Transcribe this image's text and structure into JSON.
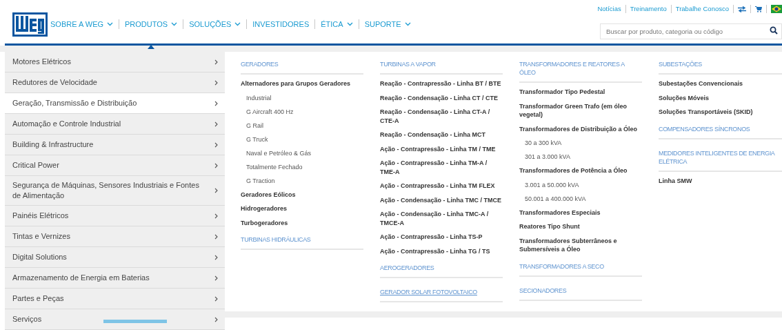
{
  "top_links": [
    "Notícias",
    "Treinamento",
    "Trabalhe Conosco"
  ],
  "search": {
    "placeholder": "Buscar por produto, categoria ou código"
  },
  "nav": [
    {
      "label": "SOBRE A WEG",
      "dropdown": true,
      "selected": false
    },
    {
      "label": "PRODUTOS",
      "dropdown": true,
      "selected": true
    },
    {
      "label": "SOLUÇÕES",
      "dropdown": true,
      "selected": false
    },
    {
      "label": "INVESTIDORES",
      "dropdown": false,
      "selected": false
    },
    {
      "label": "ÉTICA",
      "dropdown": true,
      "selected": false
    },
    {
      "label": "SUPORTE",
      "dropdown": true,
      "selected": false
    }
  ],
  "sidebar": {
    "items": [
      {
        "label": "Motores Elétricos",
        "selected": false
      },
      {
        "label": "Redutores de Velocidade",
        "selected": false
      },
      {
        "label": "Geração, Transmissão e Distribuição",
        "selected": true
      },
      {
        "label": "Automação e Controle Industrial",
        "selected": false
      },
      {
        "label": "Building & Infrastructure",
        "selected": false
      },
      {
        "label": "Critical Power",
        "selected": false
      },
      {
        "label": "Segurança de Máquinas, Sensores Industriais e Fontes de Alimentação",
        "selected": false
      },
      {
        "label": "Painéis Elétricos",
        "selected": false
      },
      {
        "label": "Tintas e Vernizes",
        "selected": false
      },
      {
        "label": "Digital Solutions",
        "selected": false
      },
      {
        "label": "Armazenamento de Energia em Baterias",
        "selected": false
      },
      {
        "label": "Partes e Peças",
        "selected": false
      },
      {
        "label": "Serviços",
        "selected": false
      }
    ]
  },
  "columns": [
    [
      {
        "title": "GERADORES",
        "hovered": false,
        "items": [
          {
            "label": "Alternadores para Grupos Geradores",
            "children": [
              {
                "label": "Industrial"
              },
              {
                "label": "G Aircraft 400 Hz"
              },
              {
                "label": "G Rail"
              },
              {
                "label": "G Truck"
              },
              {
                "label": "Naval e Petróleo & Gás"
              },
              {
                "label": "Totalmente Fechado"
              },
              {
                "label": "G Traction"
              }
            ]
          },
          {
            "label": "Geradores Eólicos"
          },
          {
            "label": "Hidrogeradores"
          },
          {
            "label": "Turbogeradores"
          }
        ]
      },
      {
        "title": "TURBINAS HIDRÁULICAS",
        "hovered": false
      }
    ],
    [
      {
        "title": "TURBINAS A VAPOR",
        "hovered": false,
        "items": [
          {
            "label": "Reação - Contrapressão - Linha BT / BTE"
          },
          {
            "label": "Reação - Condensação - Linha CT / CTE"
          },
          {
            "label": "Reação - Condensação - Linha CT-A / CTE-A"
          },
          {
            "label": "Reação - Condensação - Linha MCT"
          },
          {
            "label": "Ação - Contrapressão - Linha TM / TME"
          },
          {
            "label": "Ação - Contrapressão - Linha TM-A / TME-A"
          },
          {
            "label": "Ação - Contrapressão - Linha TM FLEX"
          },
          {
            "label": "Ação - Condensação - Linha TMC / TMCE"
          },
          {
            "label": "Ação - Condensação - Linha TMC-A / TMCE-A"
          },
          {
            "label": "Ação - Contrapressão - Linha TS-P"
          },
          {
            "label": "Ação - Contrapressão - Linha TG / TS"
          }
        ]
      },
      {
        "title": "AEROGERADORES",
        "hovered": false
      },
      {
        "title": "GERADOR SOLAR FOTOVOLTAICO",
        "hovered": true
      }
    ],
    [
      {
        "title": "TRANSFORMADORES E REATORES A ÓLEO",
        "hovered": false,
        "items": [
          {
            "label": "Transformador Tipo Pedestal"
          },
          {
            "label": "Transformador Green Trafo (em óleo vegetal)"
          },
          {
            "label": "Transformadores de Distribuição a Óleo",
            "children": [
              {
                "label": "30 a 300 kVA"
              },
              {
                "label": "301 a 3.000 kVA"
              }
            ]
          },
          {
            "label": "Transformadores de Potência a Óleo",
            "children": [
              {
                "label": "3.001 a 50.000 kVA"
              },
              {
                "label": "50.001 a 400.000 kVA"
              }
            ]
          },
          {
            "label": "Transformadores Especiais"
          },
          {
            "label": "Reatores Tipo Shunt"
          },
          {
            "label": "Transformadores Subterrâneos e Submersíveis a Óleo"
          }
        ]
      },
      {
        "title": "TRANSFORMADORES A SECO",
        "hovered": false
      },
      {
        "title": "SECIONADORES",
        "hovered": false
      }
    ],
    [
      {
        "title": "SUBESTAÇÕES",
        "hovered": false,
        "items": [
          {
            "label": "Subestações Convencionais"
          },
          {
            "label": "Soluções Móveis"
          },
          {
            "label": "Soluções Transportáveis (SKID)"
          }
        ]
      },
      {
        "title": "COMPENSADORES SÍNCRONOS",
        "hovered": false
      },
      {
        "title": "MEDIDORES INTELIGENTES DE ENERGIA ELÉTRICA",
        "hovered": false,
        "items": [
          {
            "label": "Linha SMW"
          }
        ]
      }
    ]
  ]
}
